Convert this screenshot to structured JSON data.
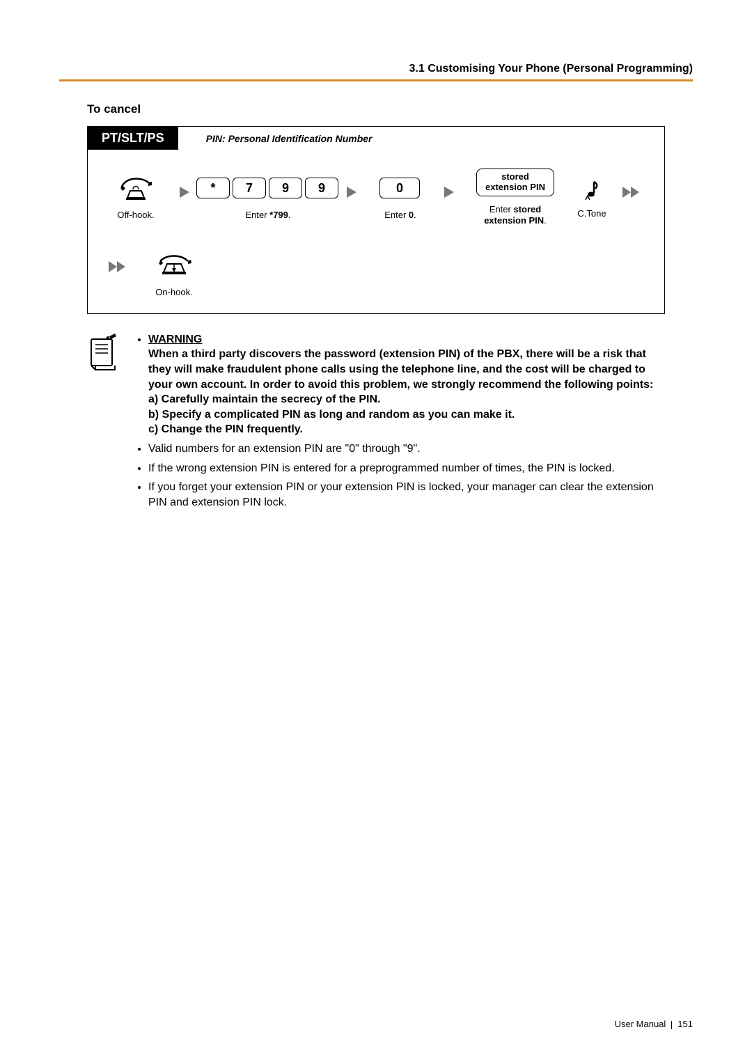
{
  "header": "3.1 Customising Your Phone (Personal Programming)",
  "section_title": "To cancel",
  "flow": {
    "badge": "PT/SLT/PS",
    "badge_note": "PIN: Personal Identification Number",
    "steps": {
      "offhook": "Off-hook.",
      "enter799_prefix": "Enter ",
      "enter799_code": "*799",
      "enter799_suffix": ".",
      "key_star": "*",
      "key_7": "7",
      "key_9a": "9",
      "key_9b": "9",
      "enter0_prefix": "Enter ",
      "enter0_code": "0",
      "enter0_suffix": ".",
      "key_0": "0",
      "stored_box_line1": "stored",
      "stored_box_line2": "extension PIN",
      "enter_stored_prefix": "Enter ",
      "enter_stored_bold": "stored",
      "enter_stored_line2_bold": "extension PIN",
      "enter_stored_suffix": ".",
      "ctone": "C.Tone",
      "onhook": "On-hook."
    }
  },
  "notes": {
    "warning_label": "WARNING",
    "warning_text": "When a third party discovers the password (extension PIN) of the PBX, there will be a risk that they will make fraudulent phone calls using the telephone line, and the cost will be charged to your own account. In order to avoid this problem, we strongly recommend the following points:",
    "warning_a": "a) Carefully maintain the secrecy of the PIN.",
    "warning_b": "b) Specify a complicated PIN as long and random as you can make it.",
    "warning_c": "c) Change the PIN frequently.",
    "bullet_valid": "Valid numbers for an extension PIN are \"0\" through \"9\".",
    "bullet_wrong": "If the wrong extension PIN is entered for a preprogrammed number of times, the PIN is locked.",
    "bullet_forget": "If you forget your extension PIN or your extension PIN is locked, your manager can clear the extension PIN and extension PIN lock."
  },
  "footer": {
    "label": "User Manual",
    "page": "151"
  }
}
